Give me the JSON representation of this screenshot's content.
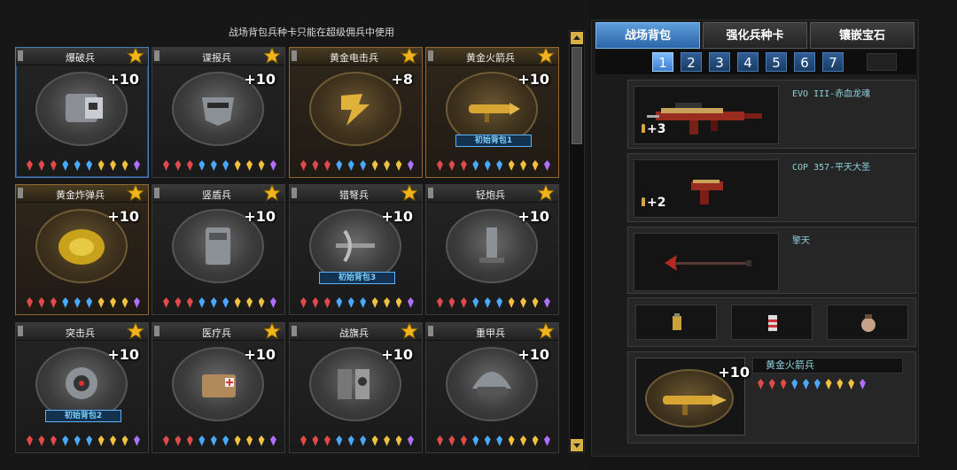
{
  "notice": "战场背包兵种卡只能在超级佣兵中使用",
  "cards": [
    {
      "name": "爆破兵",
      "plus": "+10",
      "badge": "",
      "style": "selected",
      "icon": "backpack-icon"
    },
    {
      "name": "谍报兵",
      "plus": "+10",
      "badge": "",
      "style": "",
      "icon": "mask-icon"
    },
    {
      "name": "黄金电击兵",
      "plus": "+8",
      "badge": "",
      "style": "gold",
      "icon": "lightning-gauntlet-icon"
    },
    {
      "name": "黄金火箭兵",
      "plus": "+10",
      "badge": "初始背包1",
      "style": "gold",
      "icon": "rocket-launcher-icon"
    },
    {
      "name": "黄金炸弹兵",
      "plus": "+10",
      "badge": "",
      "style": "gold",
      "icon": "bomb-icon"
    },
    {
      "name": "竖盾兵",
      "plus": "+10",
      "badge": "",
      "style": "",
      "icon": "shield-icon"
    },
    {
      "name": "猎弩兵",
      "plus": "+10",
      "badge": "初始背包3",
      "style": "",
      "icon": "crossbow-icon"
    },
    {
      "name": "轻炮兵",
      "plus": "+10",
      "badge": "",
      "style": "",
      "icon": "mortar-icon"
    },
    {
      "name": "突击兵",
      "plus": "+10",
      "badge": "初始背包2",
      "style": "",
      "icon": "target-icon"
    },
    {
      "name": "医疗兵",
      "plus": "+10",
      "badge": "",
      "style": "",
      "icon": "medkit-icon"
    },
    {
      "name": "战旗兵",
      "plus": "+10",
      "badge": "",
      "style": "",
      "icon": "flag-icon"
    },
    {
      "name": "重甲兵",
      "plus": "+10",
      "badge": "",
      "style": "",
      "icon": "helmet-icon"
    }
  ],
  "gem_colors": [
    "#e04a4a",
    "#e04a4a",
    "#e04a4a",
    "#4aa8ff",
    "#4aa8ff",
    "#4aa8ff",
    "#f0c040",
    "#f0c040",
    "#f0c040",
    "#b070ff"
  ],
  "tabs": [
    {
      "label": "战场背包",
      "active": true
    },
    {
      "label": "强化兵种卡",
      "active": false
    },
    {
      "label": "镶嵌宝石",
      "active": false
    }
  ],
  "pages": [
    "1",
    "2",
    "3",
    "4",
    "5",
    "6",
    "7"
  ],
  "active_page": "1",
  "loadout": {
    "primary": {
      "name": "EVO III-赤血龙魂",
      "ammo": "+3"
    },
    "secondary": {
      "name": "COP 357-平天大圣",
      "ammo": "+2"
    },
    "melee": {
      "name": "擎天"
    },
    "items": [
      "grenade-icon",
      "smoke-grenade-icon",
      "flashbang-icon"
    ],
    "role": {
      "name": "黄金火箭兵",
      "plus": "+10"
    }
  }
}
